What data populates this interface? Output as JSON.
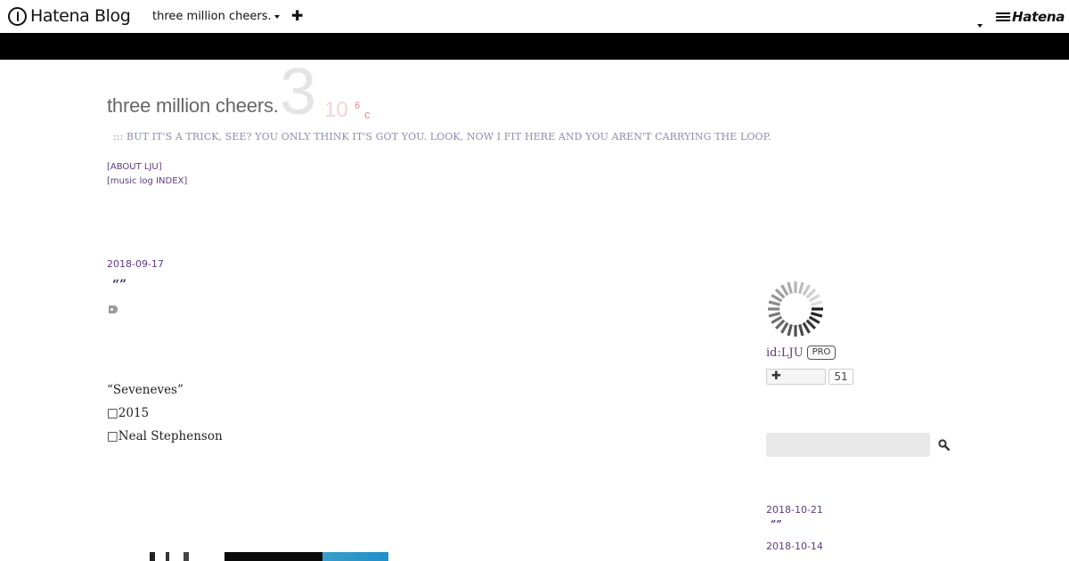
{
  "topbar": {
    "brand": "Hatena Blog",
    "blog_switcher": "three million cheers.",
    "add_icon": "plus-icon",
    "user_menu_icon": "caret-down-icon",
    "hatena_label": "Hatena"
  },
  "header": {
    "title": "three million cheers.",
    "logo_big": "3",
    "logo_ten": "10",
    "logo_exp": "6",
    "logo_unit": "c",
    "description": "::: BUT IT'S A TRICK, SEE? YOU ONLY THINK IT'S GOT YOU. LOOK, NOW I FIT HERE AND YOU AREN'T CARRYING THE LOOP.",
    "links": [
      "[ABOUT LJU]",
      "[music log INDEX]"
    ]
  },
  "entry": {
    "date": "2018-09-17",
    "title": "“”",
    "tag_icon": "tag-icon",
    "body_lines": [
      "“Seveneves”",
      "2015",
      "Neal Stephenson"
    ]
  },
  "sidebar": {
    "profile_id": "id:LJU",
    "pro_badge": "PRO",
    "follow_icon": "plus-icon",
    "follow_count": "51",
    "search_placeholder": "",
    "search_icon": "search-icon",
    "recent": [
      {
        "date": "2018-10-21",
        "title": "“”"
      },
      {
        "date": "2018-10-14",
        "title": ""
      }
    ]
  },
  "colors": {
    "link": "#5e3a82",
    "band": "#000000",
    "description": "#8c8cb4",
    "logo_accent": "#ee8888"
  }
}
